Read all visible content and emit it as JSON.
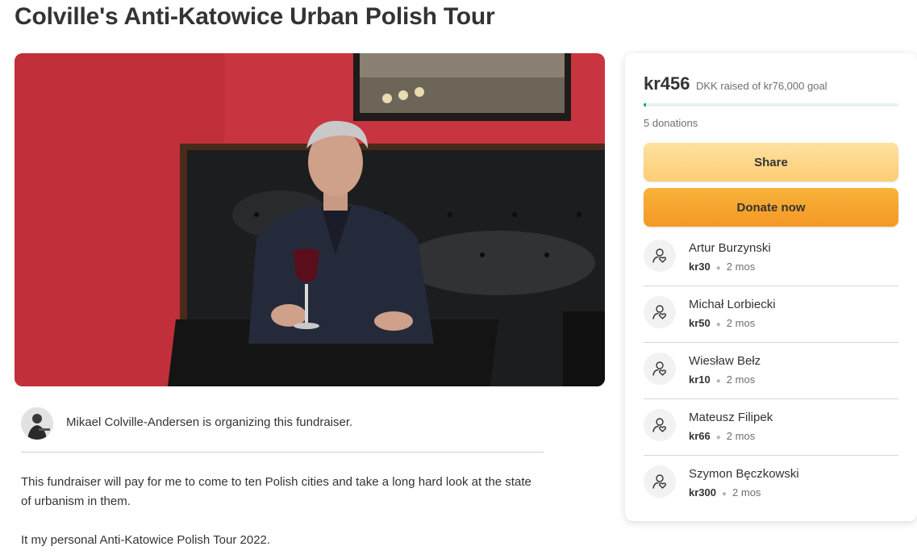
{
  "page": {
    "title": "Colville's Anti-Katowice Urban Polish Tour"
  },
  "organizer": {
    "text": "Mikael Colville-Andersen is organizing this fundraiser."
  },
  "story": {
    "paragraph_1": "This fundraiser will pay for me to come to ten Polish cities and take a long hard look at the state of urbanism in them.",
    "paragraph_2": "It my personal Anti-Katowice Polish Tour 2022."
  },
  "campaign": {
    "raised_amount": "kr456",
    "raised_goal_text": "DKK raised of kr76,000 goal",
    "progress_fraction": 0.006,
    "donations_count": "5 donations",
    "share_label": "Share",
    "donate_label": "Donate now",
    "accent_color": "#02a95c"
  },
  "donors": [
    {
      "name": "Artur Burzynski",
      "amount": "kr30",
      "time": "2 mos",
      "icon": "donor-heart-icon"
    },
    {
      "name": "Michał Lorbiecki",
      "amount": "kr50",
      "time": "2 mos",
      "icon": "donor-heart-icon"
    },
    {
      "name": "Wiesław Bełz",
      "amount": "kr10",
      "time": "2 mos",
      "icon": "donor-heart-icon"
    },
    {
      "name": "Mateusz Filipek",
      "amount": "kr66",
      "time": "2 mos",
      "icon": "donor-heart-icon"
    },
    {
      "name": "Szymon Bęczkowski",
      "amount": "kr300",
      "time": "2 mos",
      "icon": "donor-heart-icon"
    }
  ]
}
